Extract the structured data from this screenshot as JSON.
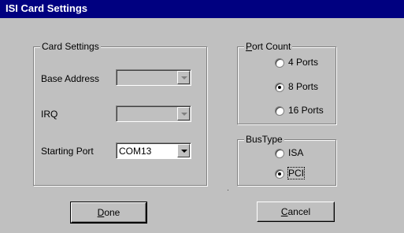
{
  "window": {
    "title": "ISI Card Settings"
  },
  "card_settings": {
    "legend": "Card Settings",
    "base_address_label": "Base Address",
    "base_address_value": "",
    "irq_label": "IRQ",
    "irq_value": "",
    "starting_port_label": "Starting Port",
    "starting_port_value": "COM13"
  },
  "port_count": {
    "legend_first": "P",
    "legend_rest": "ort Count",
    "options": [
      "4 Ports",
      "8 Ports",
      "16 Ports"
    ],
    "selected": "8 Ports"
  },
  "bus_type": {
    "legend": "BusType",
    "options": [
      "ISA",
      "PCI"
    ],
    "selected": "PCI"
  },
  "buttons": {
    "done_first": "D",
    "done_rest": "one",
    "cancel_first": "C",
    "cancel_rest": "ancel"
  }
}
